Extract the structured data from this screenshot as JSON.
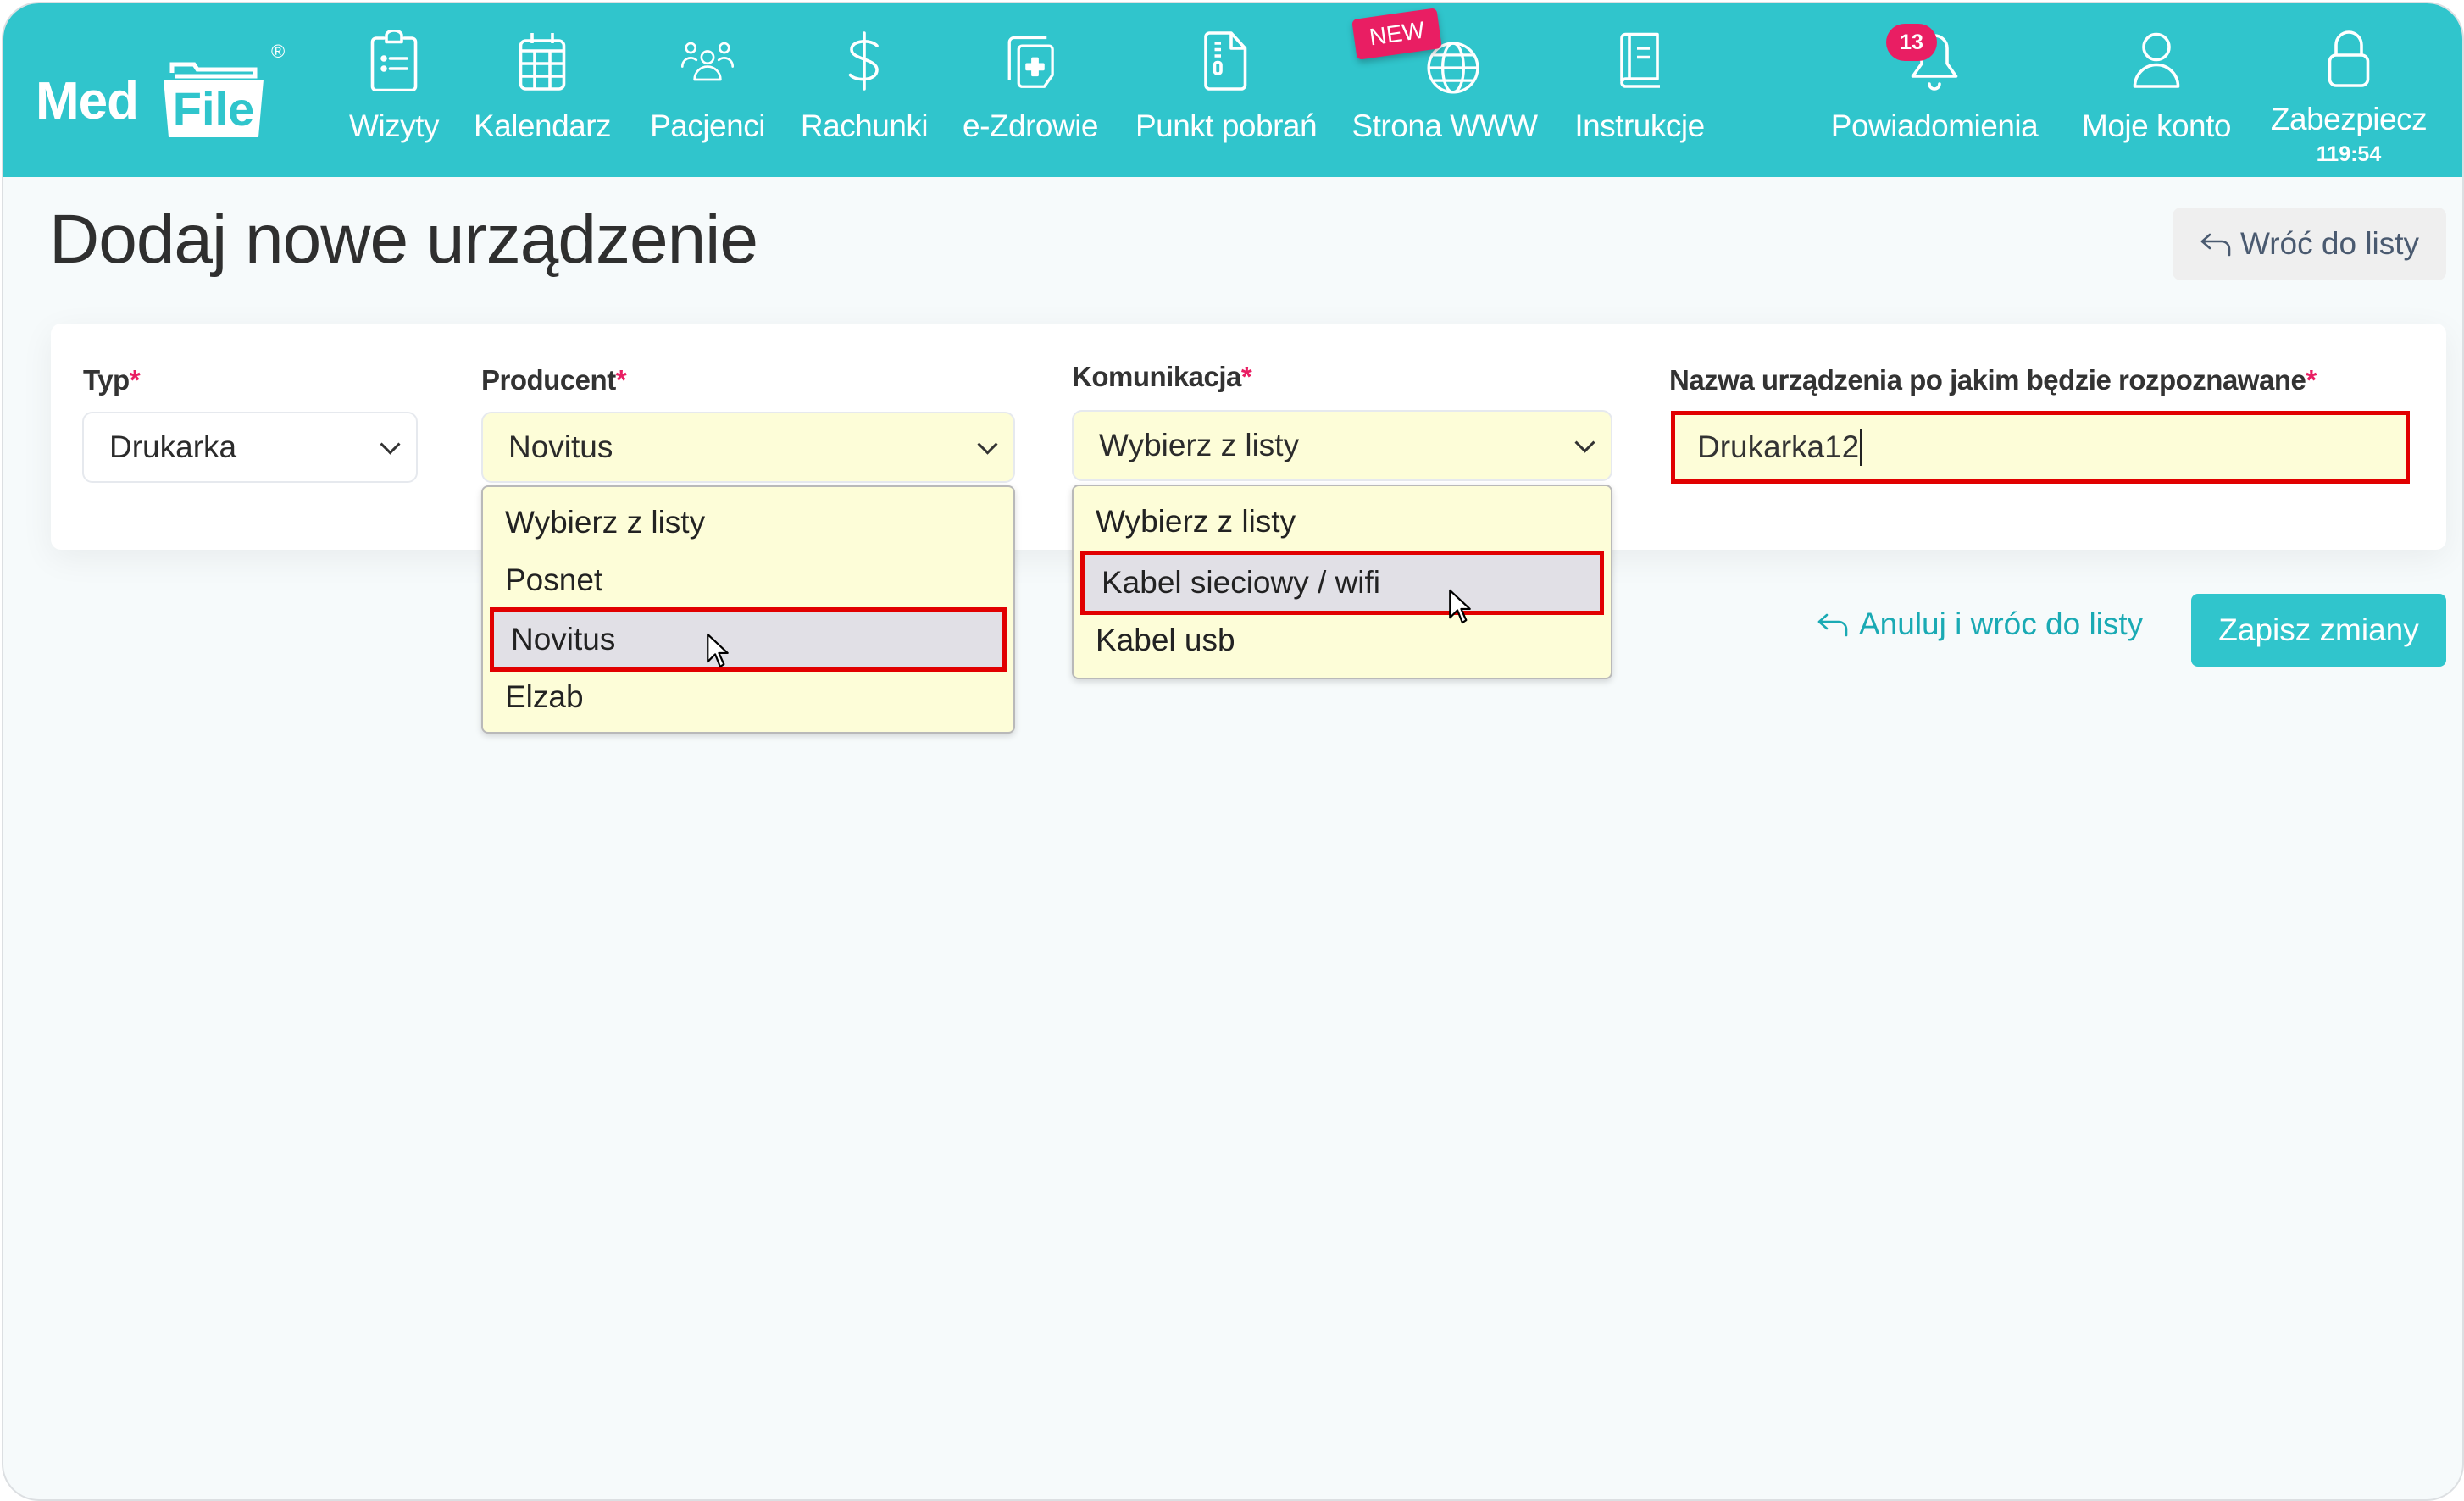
{
  "app": {
    "logo_text_left": "Med",
    "logo_text_right": "File",
    "logo_mark": "®"
  },
  "nav": {
    "items": [
      {
        "label": "Wizyty",
        "icon": "clipboard-list-icon"
      },
      {
        "label": "Kalendarz",
        "icon": "calendar-icon"
      },
      {
        "label": "Pacjenci",
        "icon": "users-icon"
      },
      {
        "label": "Rachunki",
        "icon": "dollar-icon"
      },
      {
        "label": "e-Zdrowie",
        "icon": "medical-docs-icon"
      },
      {
        "label": "Punkt pobrań",
        "icon": "document-icon"
      },
      {
        "label": "Strona WWW",
        "icon": "globe-icon",
        "badge": "NEW"
      },
      {
        "label": "Instrukcje",
        "icon": "book-icon"
      },
      {
        "label": "Powiadomienia",
        "icon": "bell-icon",
        "badge": "13"
      },
      {
        "label": "Moje konto",
        "icon": "user-icon"
      },
      {
        "label": "Zabezpiecz",
        "icon": "lock-icon",
        "sublabel": "119:54"
      }
    ]
  },
  "page": {
    "title": "Dodaj nowe urządzenie",
    "back_button": "Wróć do listy"
  },
  "form": {
    "typ": {
      "label": "Typ",
      "required_mark": "*",
      "value": "Drukarka"
    },
    "producent": {
      "label": "Producent",
      "required_mark": "*",
      "value": "Novitus",
      "options": [
        "Wybierz z listy",
        "Posnet",
        "Novitus",
        "Elzab"
      ],
      "highlighted": "Novitus"
    },
    "komunikacja": {
      "label": "Komunikacja",
      "required_mark": "*",
      "value": "Wybierz z listy",
      "options": [
        "Wybierz z listy",
        "Kabel sieciowy / wifi",
        "Kabel usb"
      ],
      "highlighted": "Kabel sieciowy / wifi"
    },
    "nazwa": {
      "label": "Nazwa urządzenia po jakim będzie rozpoznawane",
      "required_mark": "*",
      "value": "Drukarka12"
    }
  },
  "actions": {
    "cancel_label": "Anuluj i wróc do listy",
    "save_label": "Zapisz zmiany"
  },
  "colors": {
    "brand": "#30c5cc",
    "badge": "#e91e63",
    "highlight_border": "#e10000",
    "field_yellow": "#fdfdd8"
  }
}
